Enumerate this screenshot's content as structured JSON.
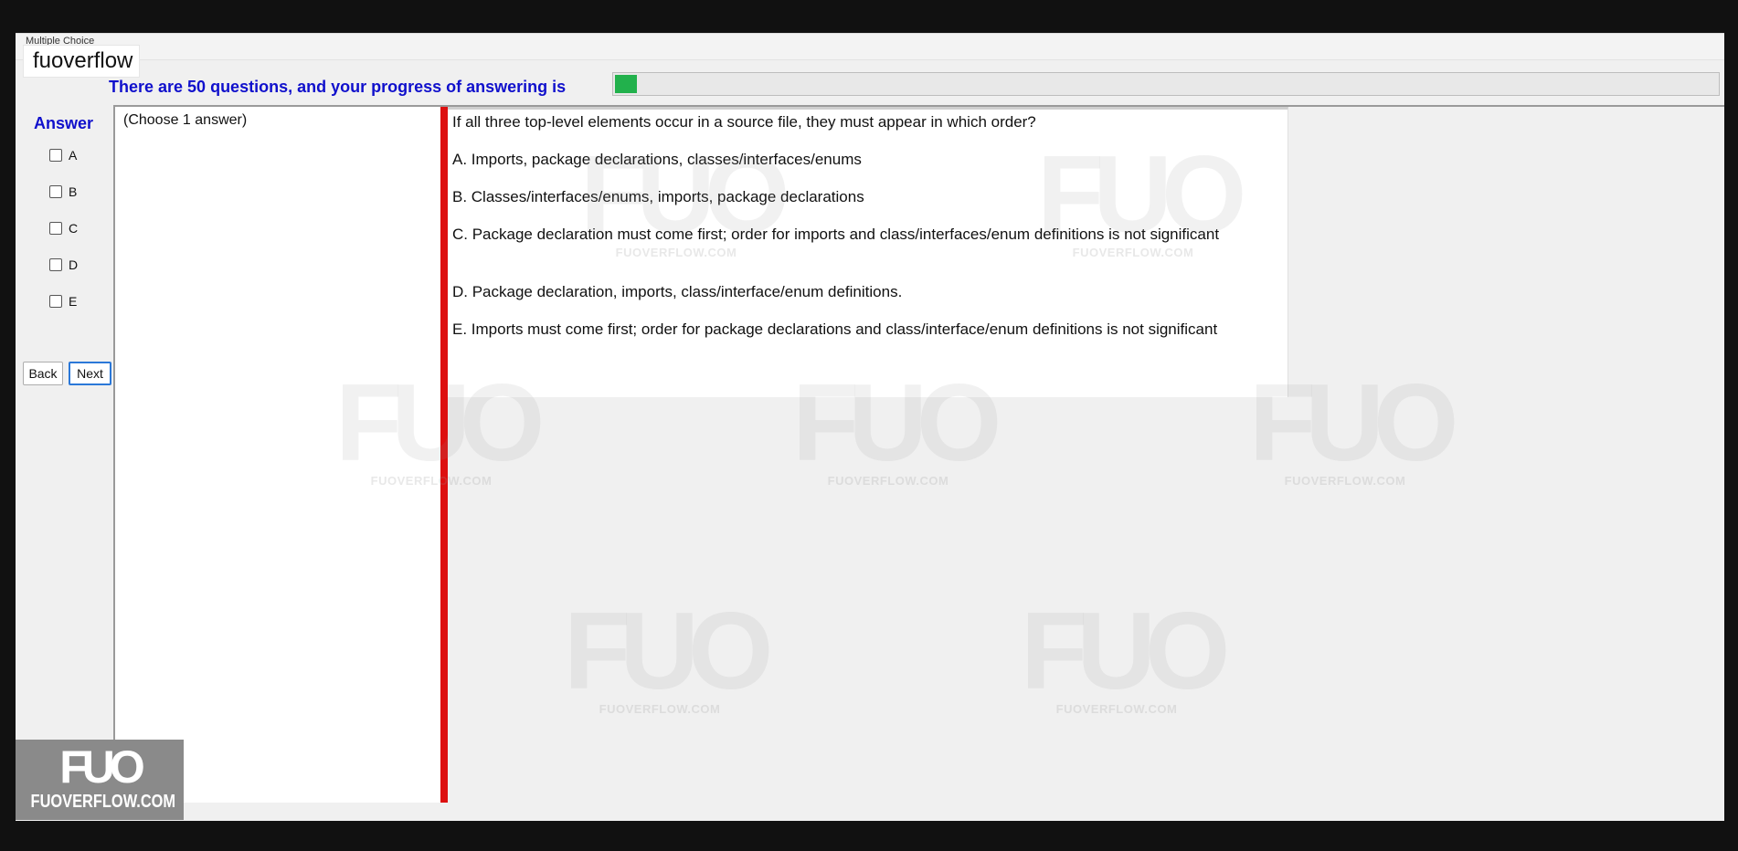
{
  "window": {
    "title_partial": "Multiple Choice"
  },
  "brand": {
    "label": "fuoverflow"
  },
  "progress": {
    "label": "There are 50 questions, and your progress of answering is",
    "total_questions": 50,
    "fill_fraction": 0.02,
    "fill_color": "#22b14c"
  },
  "answer_panel": {
    "title": "Answer",
    "options": [
      "A",
      "B",
      "C",
      "D",
      "E"
    ],
    "title_color": "#1010cc"
  },
  "nav": {
    "back_label": "Back",
    "next_label": "Next"
  },
  "instruction": {
    "text": "(Choose 1 answer)"
  },
  "question": {
    "text": "If all three top-level elements occur in a source file, they must appear in which order?",
    "choices": [
      "A.  Imports, package declarations, classes/interfaces/enums",
      "B.  Classes/interfaces/enums, imports, package declarations",
      "C.  Package declaration must come first; order for imports and class/interfaces/enum definitions is not significant",
      "D.  Package declaration, imports, class/interface/enum definitions.",
      "E.  Imports must come first; order for package declarations and class/interface/enum definitions is not significant"
    ]
  },
  "watermark": {
    "logo": "FUO",
    "site": "FUOVERFLOW.COM"
  },
  "corner_logo": {
    "mark": "FUO",
    "site": "FUOVERFLOW.COM"
  },
  "colors": {
    "splitter": "#dd1010",
    "accent_text": "#1010cc"
  }
}
